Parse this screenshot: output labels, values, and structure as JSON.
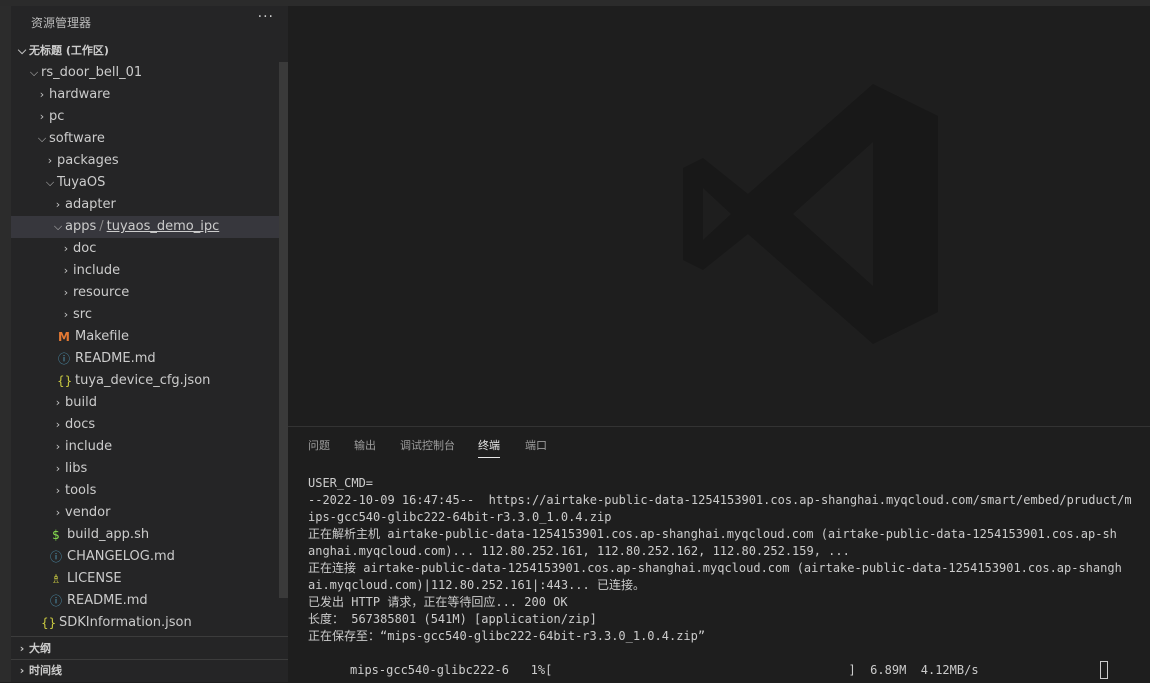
{
  "sidebar": {
    "header": "资源管理器",
    "more": "···",
    "workspace_title": "无标题 (工作区)",
    "tree": {
      "rs_door_bell_01": "rs_door_bell_01",
      "hardware": "hardware",
      "pc": "pc",
      "software": "software",
      "packages": "packages",
      "tuyaos": "TuyaOS",
      "adapter": "adapter",
      "apps": "apps",
      "apps_child": "tuyaos_demo_ipc",
      "doc": "doc",
      "include": "include",
      "resource": "resource",
      "src": "src",
      "makefile": "Makefile",
      "readme_inner": "README.md",
      "tuya_cfg": "tuya_device_cfg.json",
      "build": "build",
      "docs": "docs",
      "include2": "include",
      "libs": "libs",
      "tools": "tools",
      "vendor": "vendor",
      "build_app": "build_app.sh",
      "changelog": "CHANGELOG.md",
      "license": "LICENSE",
      "readme": "README.md",
      "sdkinfo": "SDKInformation.json"
    },
    "outline": "大纲",
    "timeline": "时间线"
  },
  "panel": {
    "tabs": [
      "问题",
      "输出",
      "调试控制台",
      "终端",
      "端口"
    ],
    "active_tab": "终端",
    "terminal_lines": [
      "USER_CMD=",
      "--2022-10-09 16:47:45--  https://airtake-public-data-1254153901.cos.ap-shanghai.myqcloud.com/smart/embed/pruduct/m",
      "ips-gcc540-glibc222-64bit-r3.3.0_1.0.4.zip",
      "正在解析主机 airtake-public-data-1254153901.cos.ap-shanghai.myqcloud.com (airtake-public-data-1254153901.cos.ap-sh",
      "anghai.myqcloud.com)... 112.80.252.161, 112.80.252.162, 112.80.252.159, ...",
      "正在连接 airtake-public-data-1254153901.cos.ap-shanghai.myqcloud.com (airtake-public-data-1254153901.cos.ap-shangh",
      "ai.myqcloud.com)|112.80.252.161|:443... 已连接。",
      "已发出 HTTP 请求，正在等待回应... 200 OK",
      "长度： 567385801 (541M) [application/zip]",
      "正在保存至：“mips-gcc540-glibc222-64bit-r3.3.0_1.0.4.zip”"
    ],
    "progress_line": "mips-gcc540-glibc222-6   1%[                                         ]  6.89M  4.12MB/s"
  },
  "colors": {
    "makefile_icon": "#e37933",
    "info_icon": "#519aba",
    "json_icon": "#cbcb41",
    "shell_icon": "#89e051",
    "license_icon": "#cbcb41"
  },
  "icons": {
    "makefile": "M",
    "info": "ⓘ",
    "json": "{}",
    "shell": "$",
    "license": "♗"
  }
}
